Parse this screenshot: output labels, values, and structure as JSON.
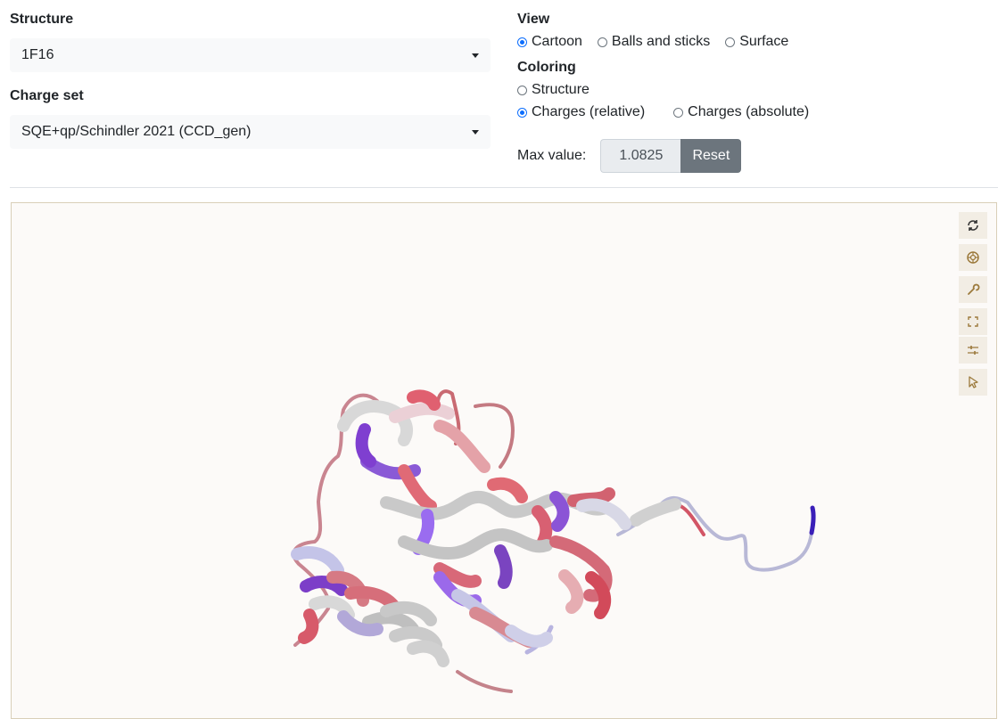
{
  "structure": {
    "label": "Structure",
    "selected": "1F16"
  },
  "charge_set": {
    "label": "Charge set",
    "selected": "SQE+qp/Schindler 2021 (CCD_gen)"
  },
  "view": {
    "label": "View",
    "options": [
      "Cartoon",
      "Balls and sticks",
      "Surface"
    ],
    "selected": "Cartoon"
  },
  "coloring": {
    "label": "Coloring",
    "options": [
      "Structure",
      "Charges (relative)",
      "Charges (absolute)"
    ],
    "selected": "Charges (relative)"
  },
  "max_value": {
    "label": "Max value:",
    "value": "1.0825",
    "reset_label": "Reset"
  },
  "viewer_toolbar": {
    "icons": [
      "reset-view-icon",
      "screenshot-icon",
      "wrench-icon",
      "expand-icon",
      "settings-sliders-icon",
      "selection-mode-icon"
    ]
  },
  "colors": {
    "accent": "#0d6efd",
    "reset_button": "#6c757d",
    "negative_charge": "#8b5cf6",
    "positive_charge": "#e8636f",
    "neutral": "#d0d0d0"
  }
}
